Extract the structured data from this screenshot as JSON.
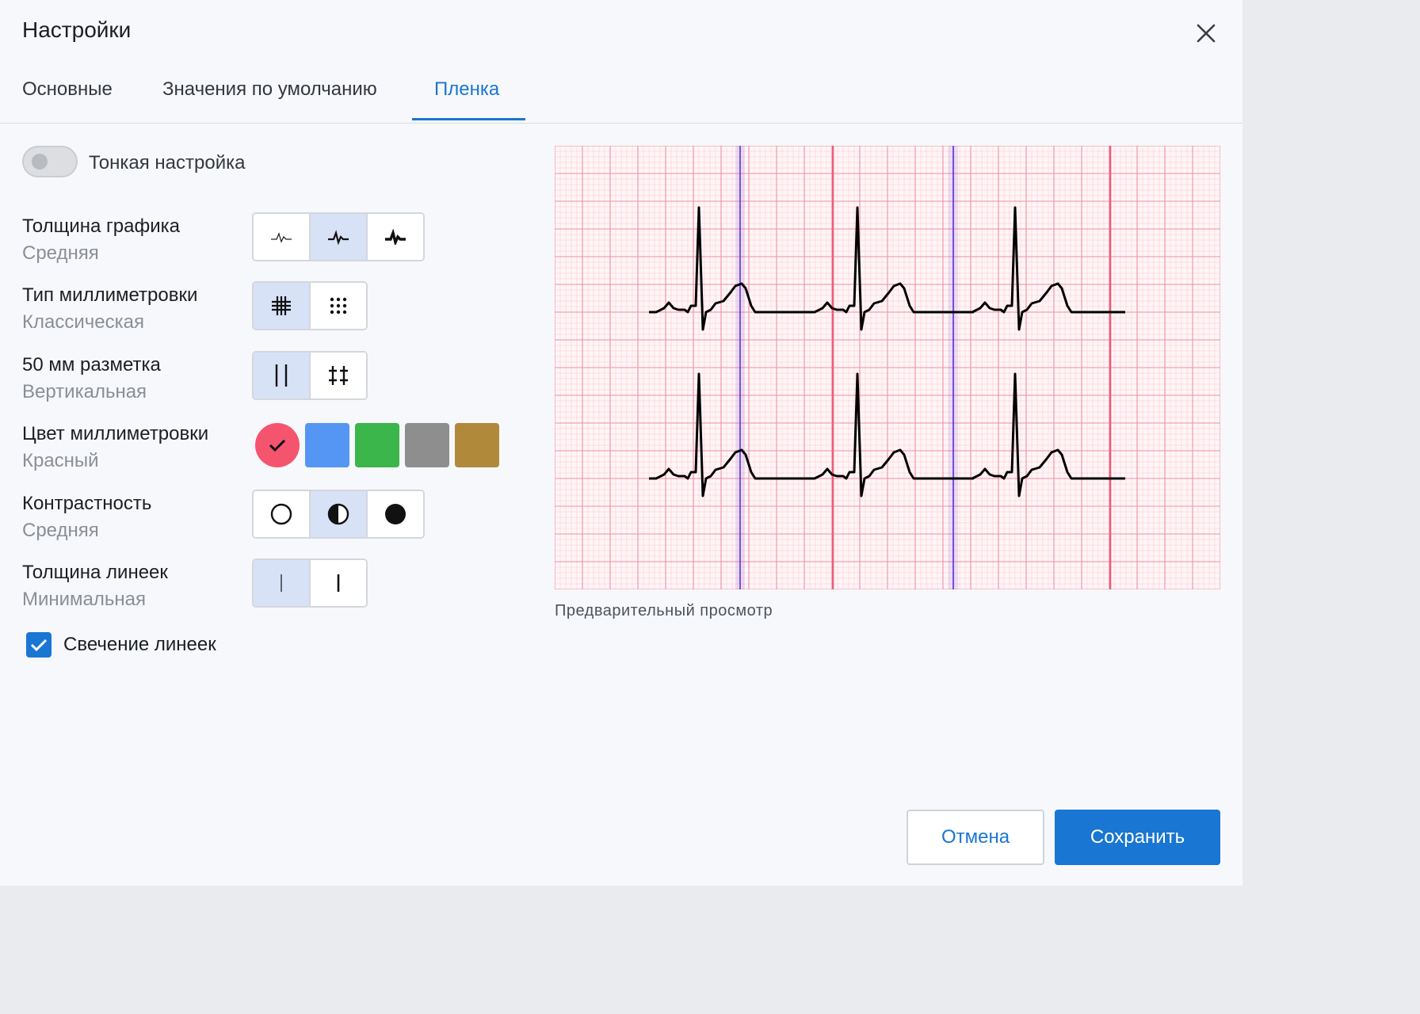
{
  "dialog": {
    "title": "Настройки",
    "close_icon": "close-icon"
  },
  "tabs": [
    {
      "label": "Основные",
      "active": false
    },
    {
      "label": "Значения по умолчанию",
      "active": false
    },
    {
      "label": "Пленка",
      "active": true
    }
  ],
  "fine_tune": {
    "label": "Тонкая настройка",
    "enabled": false
  },
  "settings": {
    "line_thickness": {
      "label": "Толщина графика",
      "value": "Средняя",
      "options": [
        "thin-line-icon",
        "medium-line-icon",
        "thick-line-icon"
      ],
      "selected": 1
    },
    "grid_type": {
      "label": "Тип миллиметровки",
      "value": "Классическая",
      "options": [
        "grid-icon",
        "dots-icon"
      ],
      "selected": 0
    },
    "markup_50mm": {
      "label": "50 мм разметка",
      "value": "Вертикальная",
      "options": [
        "vertical-lines-icon",
        "crosses-icon"
      ],
      "selected": 0
    },
    "grid_color": {
      "label": "Цвет миллиметровки",
      "value": "Красный",
      "colors": [
        "#f5546e",
        "#5596f5",
        "#3bb64a",
        "#8e8e8e",
        "#b0893b"
      ],
      "selected": 0
    },
    "contrast": {
      "label": "Контрастность",
      "value": "Средняя",
      "options": [
        "circle-empty-icon",
        "circle-half-icon",
        "circle-filled-icon"
      ],
      "selected": 1
    },
    "ruler_thickness": {
      "label": "Толщина линеек",
      "value": "Минимальная",
      "options": [
        "thin-ruler-icon",
        "thick-ruler-icon"
      ],
      "selected": 0
    }
  },
  "ruler_glow": {
    "label": "Свечение линеек",
    "checked": true
  },
  "preview": {
    "caption": "Предварительный просмотр",
    "grid_color": "#f08fa0",
    "ruler_color": "#5b2fd6"
  },
  "buttons": {
    "cancel": "Отмена",
    "save": "Сохранить"
  },
  "colors": {
    "accent": "#1976d2",
    "selected_bg": "#d7e2f7"
  }
}
